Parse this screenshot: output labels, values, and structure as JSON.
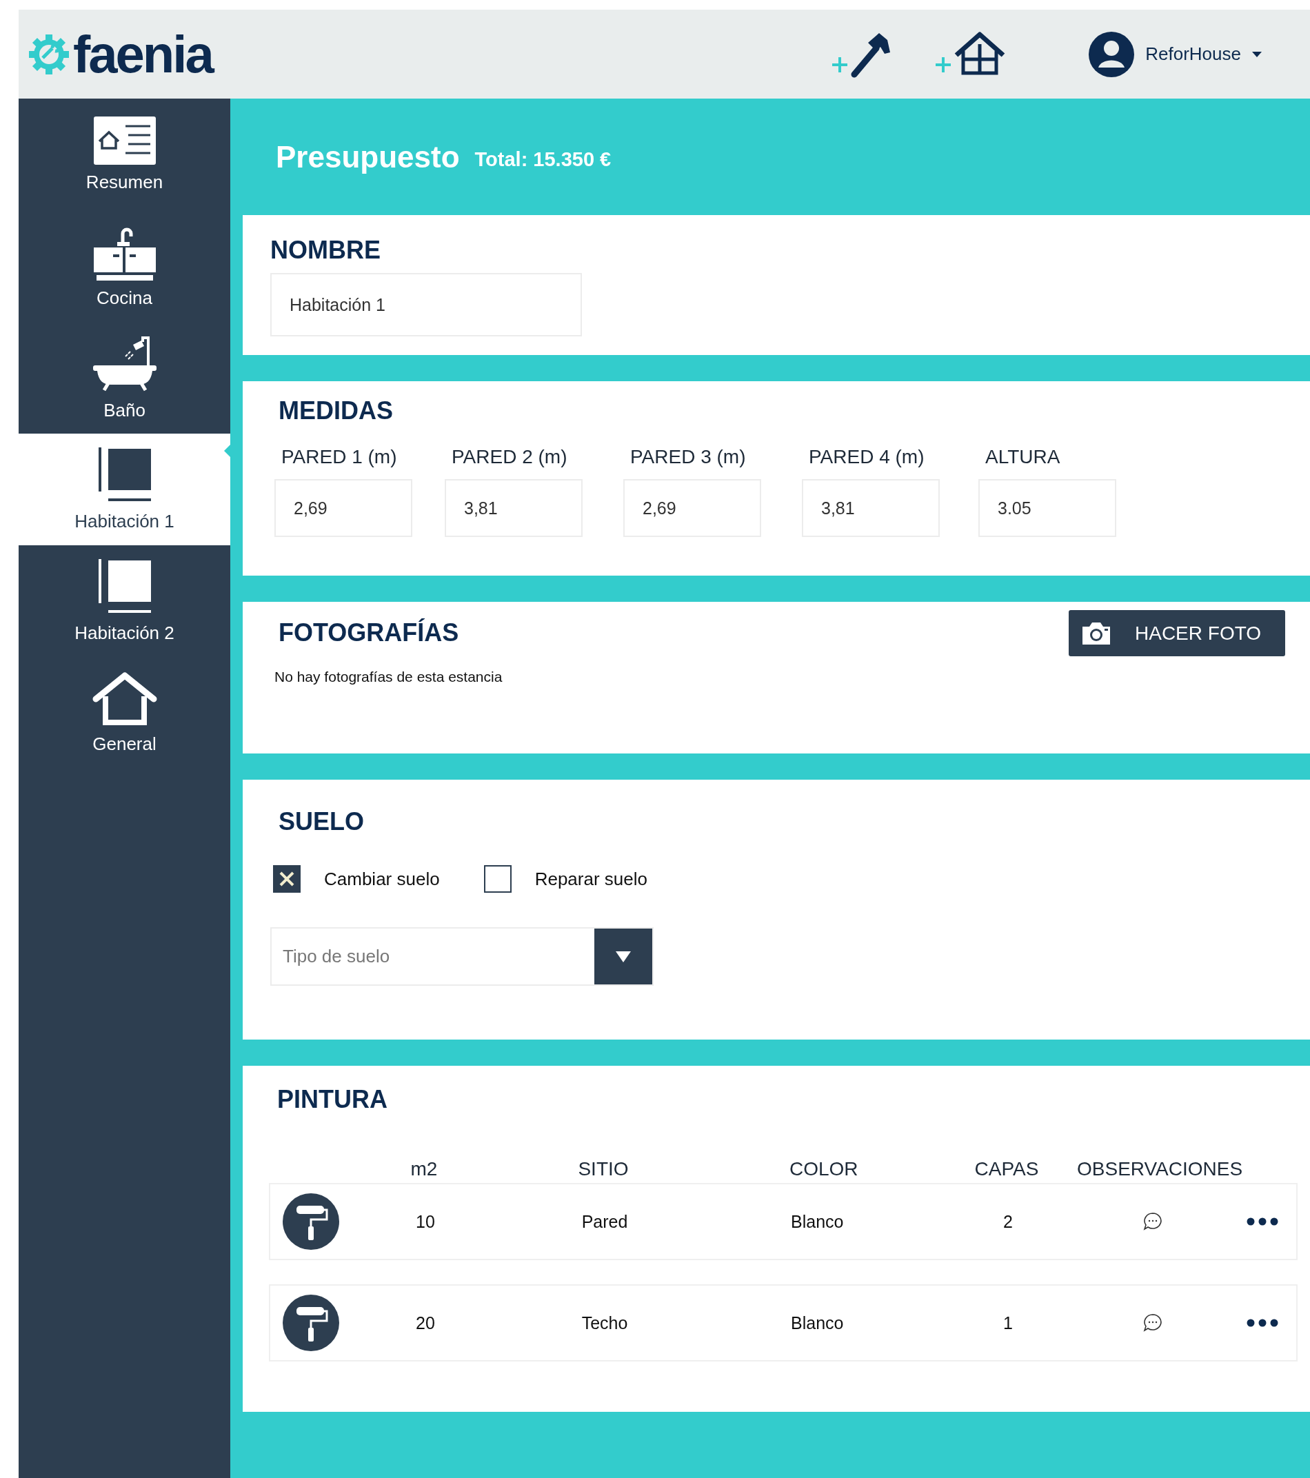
{
  "header": {
    "logo": "faenia",
    "user": "ReforHouse",
    "actions": [
      {
        "kind": "hammer"
      },
      {
        "kind": "house"
      }
    ]
  },
  "sidebar": {
    "items": [
      {
        "label": "Resumen",
        "kind": "summary",
        "selected": false
      },
      {
        "label": "Cocina",
        "kind": "kitchen",
        "selected": false
      },
      {
        "label": "Baño",
        "kind": "bath",
        "selected": false
      },
      {
        "label": "Habitación 1",
        "kind": "room",
        "selected": true
      },
      {
        "label": "Habitación 2",
        "kind": "room",
        "selected": false
      },
      {
        "label": "General",
        "kind": "home",
        "selected": false
      }
    ]
  },
  "page": {
    "title": "Presupuesto",
    "total": "Total: 15.350 €"
  },
  "nombre": {
    "heading": "NOMBRE",
    "value": "Habitación 1"
  },
  "medidas": {
    "heading": "MEDIDAS",
    "fields": [
      {
        "label": "PARED 1 (m)",
        "value": "2,69"
      },
      {
        "label": "PARED 2 (m)",
        "value": "3,81"
      },
      {
        "label": "PARED 3 (m)",
        "value": "2,69"
      },
      {
        "label": "PARED 4 (m)",
        "value": "3,81"
      },
      {
        "label": "ALTURA",
        "value": "3.05"
      }
    ]
  },
  "fotografias": {
    "heading": "FOTOGRAFÍAS",
    "button": "HACER FOTO",
    "empty_text": "No hay fotografías de esta estancia"
  },
  "suelo": {
    "heading": "SUELO",
    "options": [
      {
        "label": "Cambiar suelo",
        "checked": true
      },
      {
        "label": "Reparar suelo",
        "checked": false
      }
    ],
    "select": {
      "placeholder": "Tipo de suelo"
    }
  },
  "pintura": {
    "heading": "PINTURA",
    "columns": [
      "m2",
      "SITIO",
      "COLOR",
      "CAPAS",
      "OBSERVACIONES"
    ],
    "rows": [
      {
        "cells": [
          "10",
          "Pared",
          "Blanco",
          "2"
        ]
      },
      {
        "cells": [
          "20",
          "Techo",
          "Blanco",
          "1"
        ]
      }
    ]
  }
}
